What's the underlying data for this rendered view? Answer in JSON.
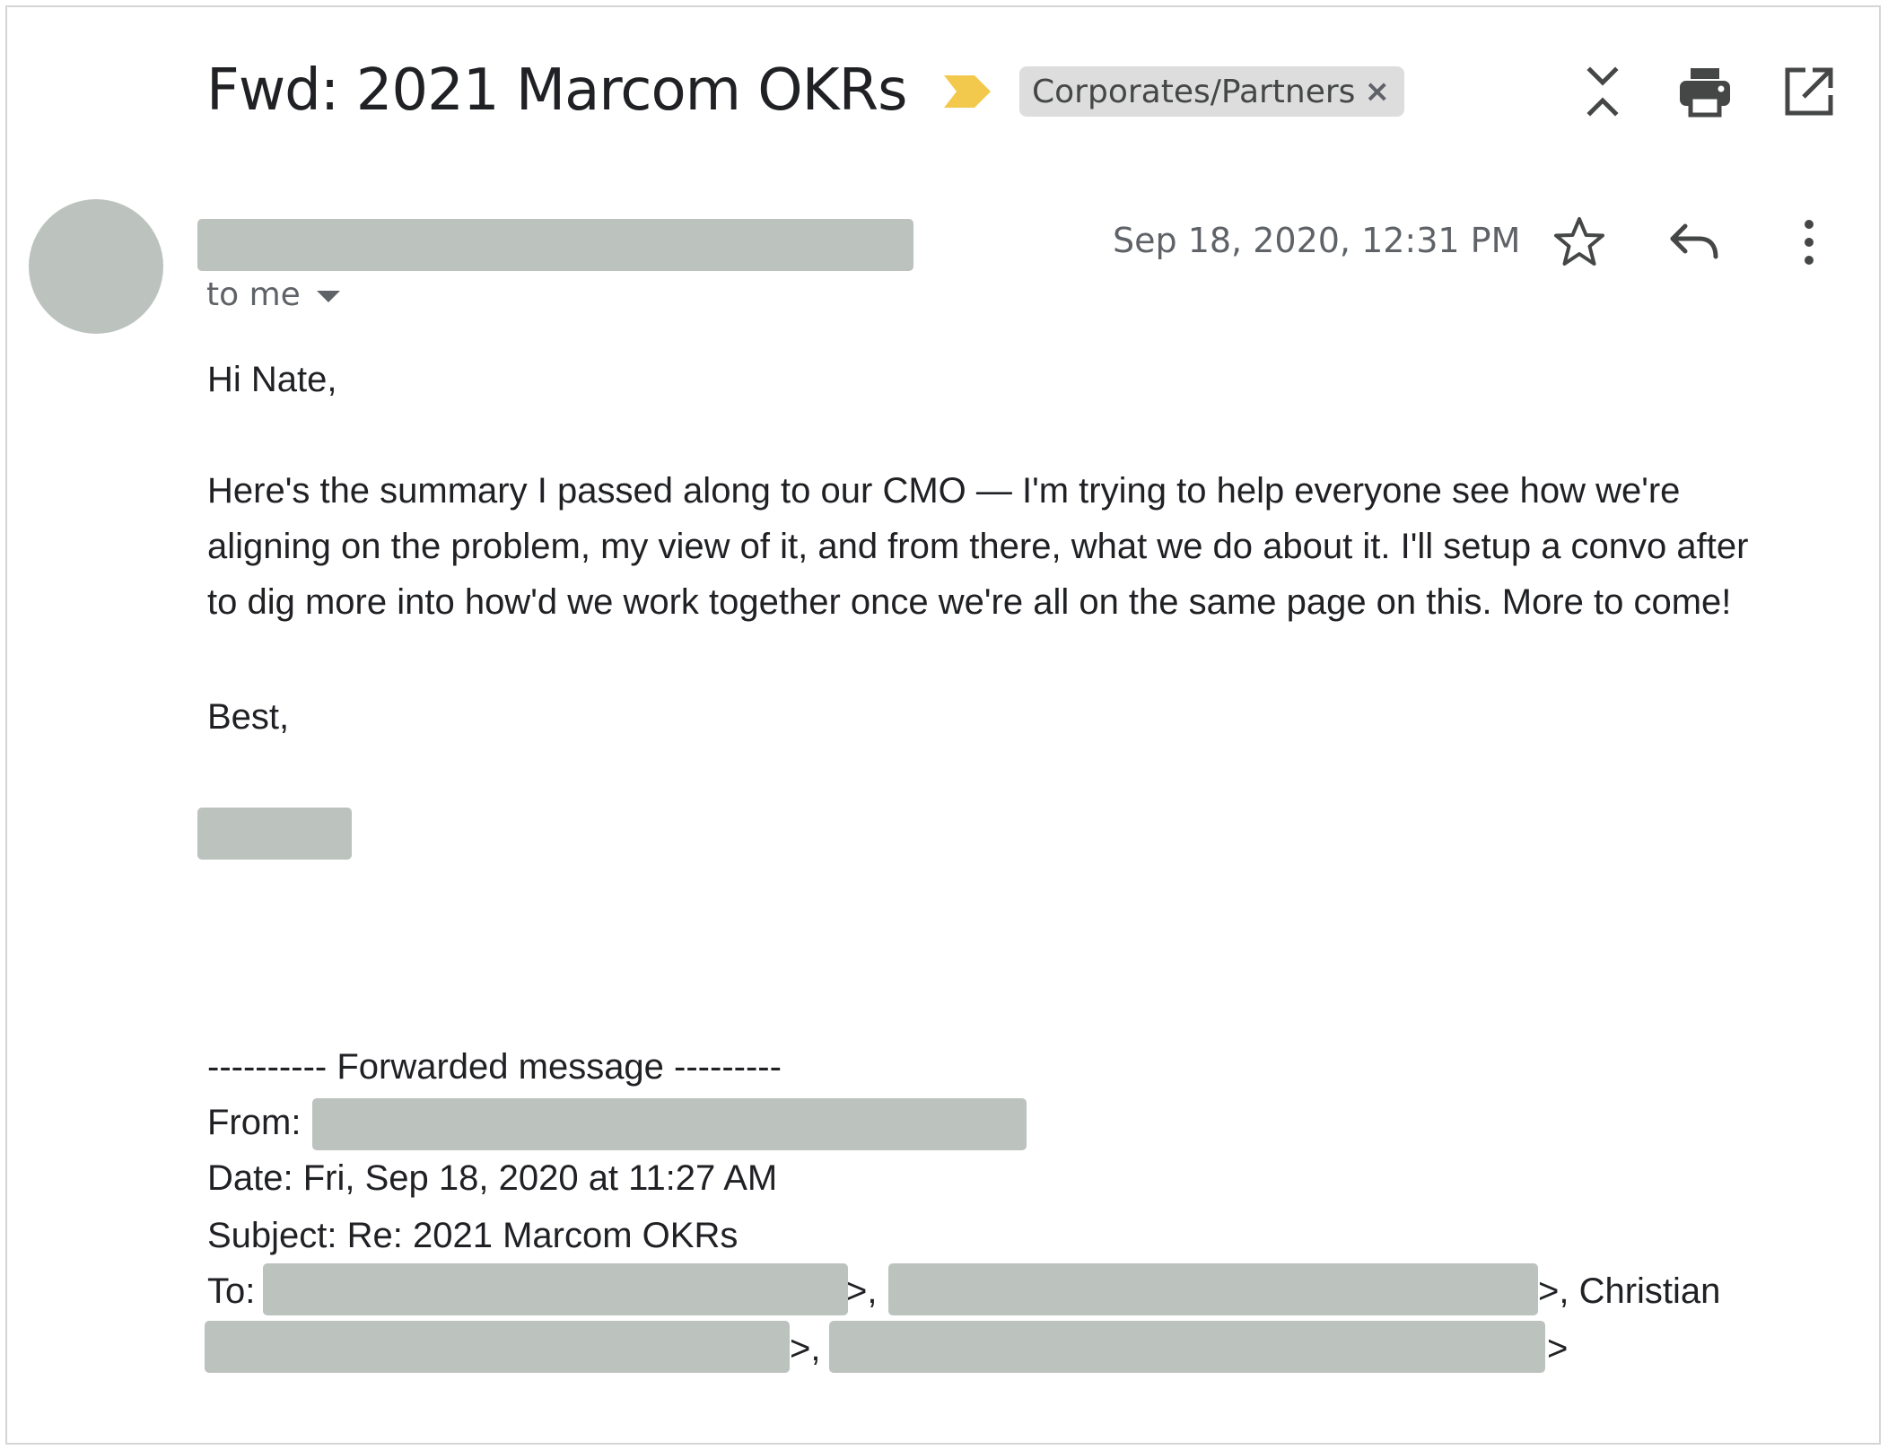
{
  "header": {
    "subject": "Fwd: 2021 Marcom OKRs",
    "label": "Corporates/Partners",
    "label_remove": "×",
    "importance_color": "#f2c94c",
    "icons": [
      "expand-collapse-icon",
      "print-icon",
      "open-in-new-window-icon"
    ]
  },
  "message": {
    "recipient_line": "to me",
    "date": "Sep 18, 2020, 12:31 PM",
    "icons": [
      "star-icon",
      "reply-icon",
      "more-vert-icon"
    ]
  },
  "body": {
    "greeting": "Hi Nate,",
    "paragraph_lines": [
      "Here's the summary I passed along to our CMO — I'm trying to help everyone see how we're",
      "aligning on the problem, my view of it, and from there, what we do about it. I'll setup a convo after",
      "to dig more into how'd we work together once we're all on the same page on this. More to come!"
    ],
    "signoff": "Best,"
  },
  "forwarded": {
    "divider": "---------- Forwarded message ---------",
    "from_label": "From:",
    "date_line": "Date: Fri, Sep 18, 2020 at 11:27 AM",
    "subject_line": "Subject: Re: 2021 Marcom OKRs",
    "to_label": "To:",
    "sep1": ">,",
    "sep2": ">, Christian",
    "sep3": ">,",
    "sep4": ">"
  },
  "colors": {
    "redaction": "#bcc2bd",
    "text": "#202124",
    "secondary_text": "#5f6368"
  }
}
